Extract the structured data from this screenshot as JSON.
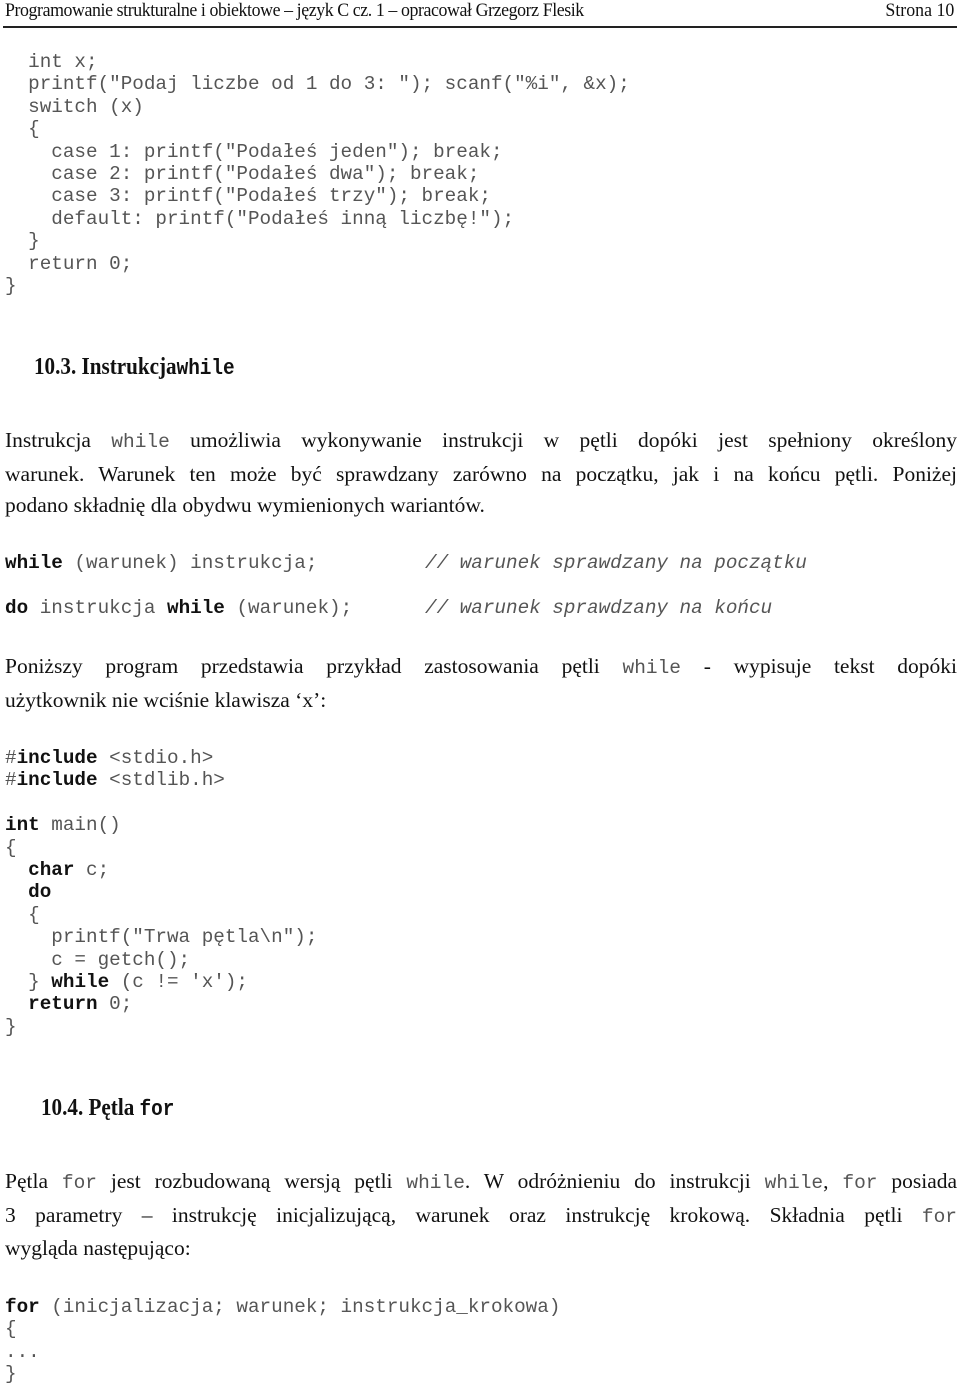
{
  "header": {
    "title": "Programowanie strukturalne i obiektowe – język C cz. 1 – opracował Grzegorz Flesik",
    "page": "Strona 10"
  },
  "code1": [
    "  int x;",
    "  printf(\"Podaj liczbe od 1 do 3: \"); scanf(\"%i\", &x);",
    "  switch (x)",
    "  {",
    "    case 1: printf(\"Podałeś jeden\"); break;",
    "    case 2: printf(\"Podałeś dwa\"); break;",
    "    case 3: printf(\"Podałeś trzy\"); break;",
    "    default: printf(\"Podałeś inną liczbę!\");",
    "  }",
    "  return 0;",
    "}"
  ],
  "section_while": {
    "number": "10.3.",
    "title": "Instrukcja",
    "keyword": "while"
  },
  "para_while": {
    "l1_a": "Instrukcja",
    "l1_kw": "while",
    "l1_b": "umożliwia wykonywanie instrukcji w pętli dopóki jest spełniony określony",
    "l2": "warunek. Warunek ten może być sprawdzany zarówno na początku, jak i na końcu pętli. Poniżej",
    "l3": "podano składnię dla obydwu wymienionych wariantów."
  },
  "syntax": {
    "s1_kw": "while",
    "s1_rest": " (warunek) instrukcja;",
    "s1_comment": "// warunek sprawdzany na początku",
    "s2_kw1": "do",
    "s2_mid": " instrukcja ",
    "s2_kw2": "while",
    "s2_rest": " (warunek);",
    "s2_comment": "// warunek sprawdzany na końcu"
  },
  "para_example": {
    "l1_a": "Poniższy program przedstawia przykład zastosowania pętli",
    "l1_kw": "while",
    "l1_b": "- wypisuje tekst dopóki",
    "l2": "użytkownik nie wciśnie klawisza ‘x’:"
  },
  "code2": {
    "inc1_hash": "#",
    "inc1_kw": "include",
    "inc1_rest": " <stdio.h>",
    "inc2_hash": "#",
    "inc2_kw": "include",
    "inc2_rest": " <stdlib.h>",
    "main_kw": "int",
    "main_rest": " main()",
    "open": "{",
    "char_kw": "char",
    "char_rest": " c;",
    "do_kw": "do",
    "open2": "  {",
    "printf": "    printf(\"Trwa pętla\\n\");",
    "getch": "    c = getch();",
    "close_a": "  } ",
    "while_kw": "while",
    "while_rest": " (c != 'x');",
    "return_kw": "return",
    "return_rest": " 0;",
    "close": "}"
  },
  "section_for": {
    "number": "10.4.",
    "title": "Pętla",
    "keyword": "for"
  },
  "para_for": {
    "l1_a": "Pętla",
    "l1_kw1": "for",
    "l1_b": "jest rozbudowaną wersją pętli",
    "l1_kw2": "while",
    "l1_c": ". W odróżnieniu do instrukcji",
    "l1_kw3": "while",
    "l1_d": ",",
    "l1_kw4": "for",
    "l1_e": "posiada",
    "l2_a": "3 parametry – instrukcję inicjalizującą, warunek oraz instrukcję krokową. Składnia pętli",
    "l2_kw": "for",
    "l3": "wygląda następująco:"
  },
  "code3": {
    "for_kw": "for",
    "for_rest": " (inicjalizacja; warunek; instrukcja_krokowa)",
    "open": "{",
    "dots": "...",
    "close": "}"
  }
}
